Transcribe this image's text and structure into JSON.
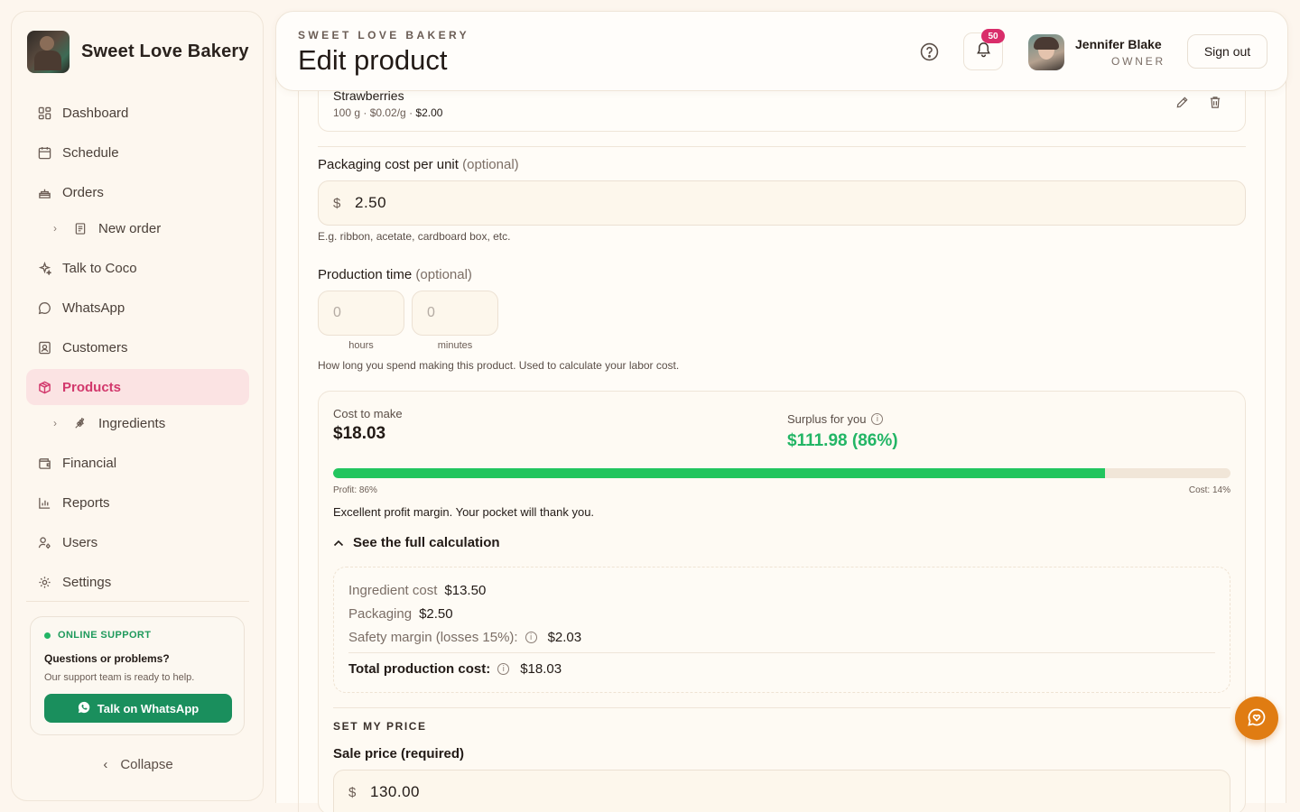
{
  "brand": {
    "name": "Sweet Love Bakery"
  },
  "nav": {
    "dashboard": "Dashboard",
    "schedule": "Schedule",
    "orders": "Orders",
    "new_order": "New order",
    "talk_coco": "Talk to Coco",
    "whatsapp": "WhatsApp",
    "customers": "Customers",
    "products": "Products",
    "ingredients": "Ingredients",
    "financial": "Financial",
    "reports": "Reports",
    "users": "Users",
    "settings": "Settings",
    "collapse": "Collapse"
  },
  "support": {
    "status": "ONLINE SUPPORT",
    "title": "Questions or problems?",
    "text": "Our support team is ready to help.",
    "button": "Talk on WhatsApp"
  },
  "header": {
    "eyebrow": "SWEET LOVE BAKERY",
    "title": "Edit product",
    "notification_count": "50",
    "user_name": "Jennifer Blake",
    "user_role": "OWNER",
    "sign_out": "Sign out"
  },
  "ingredient": {
    "name": "Strawberries",
    "meta_prefix": "100 g · $0.02/g · ",
    "meta_total": "$2.00"
  },
  "packaging": {
    "label": "Packaging cost per unit",
    "optional": "(optional)",
    "currency": "$",
    "value": "2.50",
    "hint": "E.g. ribbon, acetate, cardboard box, etc."
  },
  "production": {
    "label": "Production time",
    "optional": "(optional)",
    "hours_placeholder": "0",
    "minutes_placeholder": "0",
    "hours_label": "hours",
    "minutes_label": "minutes",
    "hint": "How long you spend making this product. Used to calculate your labor cost."
  },
  "summary": {
    "cost_label": "Cost to make",
    "cost_value": "$18.03",
    "surplus_label": "Surplus for you",
    "surplus_value": "$111.98 (86%)",
    "profit_fraction": 0.86,
    "profit_label": "Profit: 86%",
    "cost_pct_label": "Cost: 14%",
    "verdict": "Excellent profit margin. Your pocket will thank you.",
    "toggle": "See the full calculation",
    "colors": {
      "profit_bar": "#22c55e",
      "surplus_text": "#22b565"
    }
  },
  "breakdown": {
    "ingredient_label": "Ingredient cost",
    "ingredient_value": "$13.50",
    "packaging_label": "Packaging",
    "packaging_value": "$2.50",
    "safety_label": "Safety margin (losses 15%):",
    "safety_value": "$2.03",
    "total_label": "Total production cost:",
    "total_value": "$18.03"
  },
  "pricing": {
    "section": "SET MY PRICE",
    "sale_label": "Sale price (required)",
    "currency": "$",
    "sale_value": "130.00"
  },
  "accent": {
    "primary": "#d2386c",
    "whatsapp": "#1a8f5d",
    "fab": "#e07c12"
  }
}
